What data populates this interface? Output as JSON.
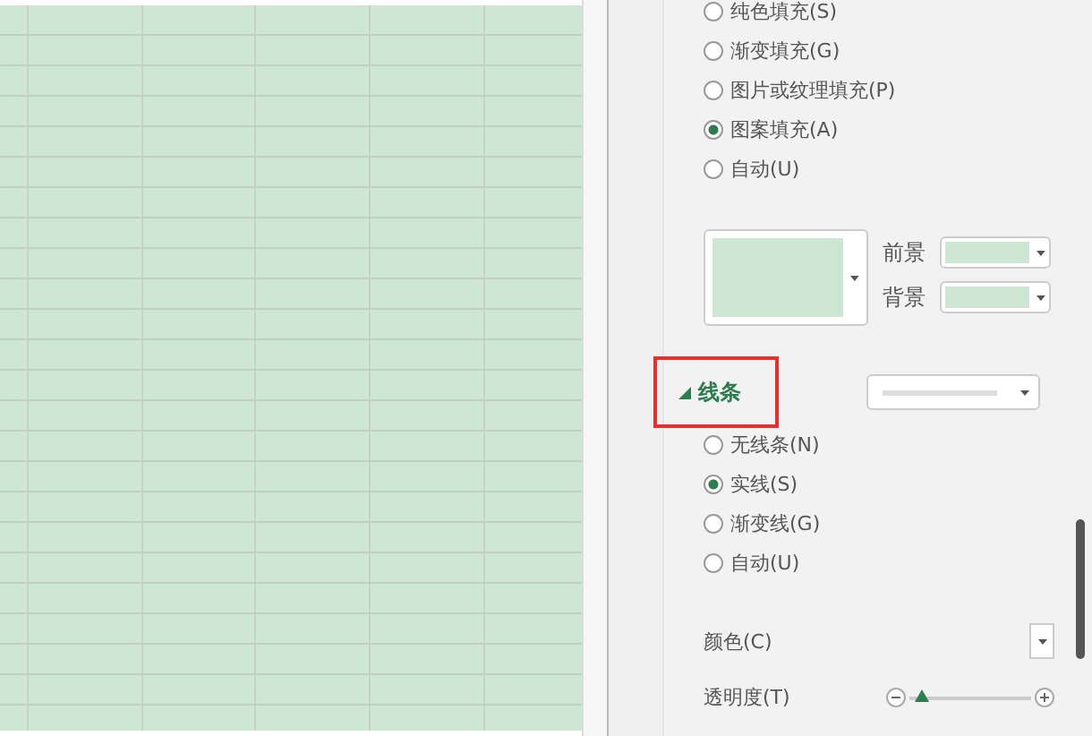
{
  "fill_options": [
    {
      "label": "纯色填充(S)",
      "selected": false
    },
    {
      "label": "渐变填充(G)",
      "selected": false
    },
    {
      "label": "图片或纹理填充(P)",
      "selected": false
    },
    {
      "label": "图案填充(A)",
      "selected": true
    },
    {
      "label": "自动(U)",
      "selected": false
    }
  ],
  "pattern": {
    "foreground_label": "前景",
    "background_label": "背景"
  },
  "line_section": {
    "title": "线条",
    "expanded": true,
    "highlighted": true
  },
  "line_options": [
    {
      "label": "无线条(N)",
      "selected": false
    },
    {
      "label": "实线(S)",
      "selected": true
    },
    {
      "label": "渐变线(G)",
      "selected": false
    },
    {
      "label": "自动(U)",
      "selected": false
    }
  ],
  "color_label": "颜色(C)",
  "transparency": {
    "label": "透明度(T)",
    "level": 0.1
  }
}
